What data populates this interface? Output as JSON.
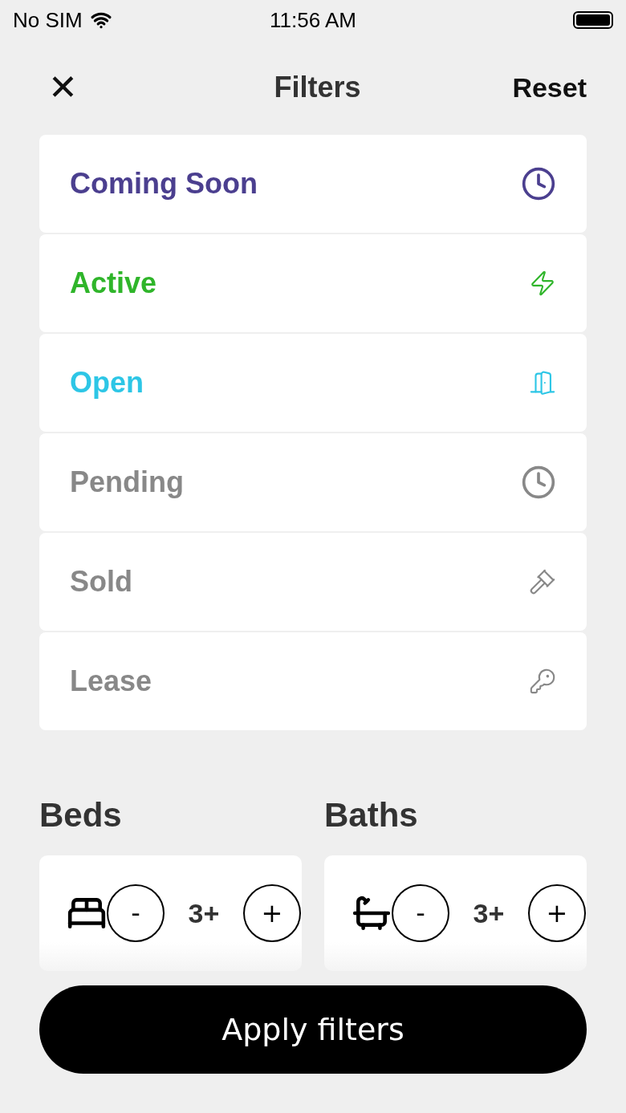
{
  "status_bar": {
    "carrier": "No SIM",
    "time": "11:56 AM"
  },
  "header": {
    "close": "✕",
    "title": "Filters",
    "reset": "Reset"
  },
  "statuses": [
    {
      "label": "Coming Soon",
      "kind": "clock",
      "selected": true,
      "color": "#4b3f8f"
    },
    {
      "label": "Active",
      "kind": "bolt",
      "selected": true,
      "color": "#2fb52a"
    },
    {
      "label": "Open",
      "kind": "door",
      "selected": true,
      "color": "#2dc6e6"
    },
    {
      "label": "Pending",
      "kind": "clock",
      "selected": false
    },
    {
      "label": "Sold",
      "kind": "gavel",
      "selected": false
    },
    {
      "label": "Lease",
      "kind": "key",
      "selected": false
    }
  ],
  "counters": [
    {
      "title": "Beds",
      "kind": "bed",
      "minus": "-",
      "value": "3+",
      "plus": "+"
    },
    {
      "title": "Baths",
      "kind": "bath",
      "minus": "-",
      "value": "3+",
      "plus": "+"
    }
  ],
  "apply_button": "Apply filters"
}
